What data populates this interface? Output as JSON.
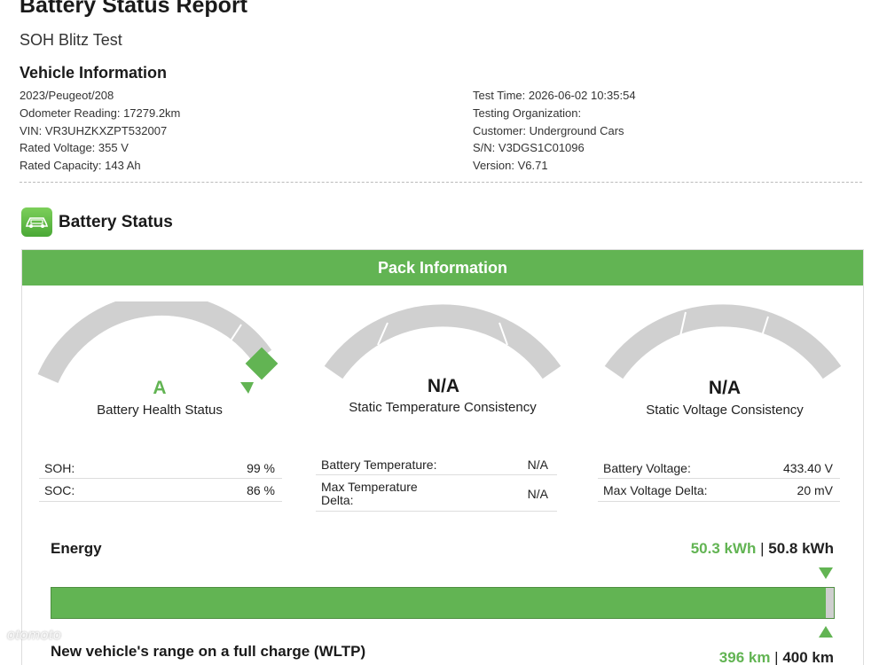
{
  "report": {
    "title": "Battery Status Report",
    "subtitle": "SOH Blitz Test"
  },
  "vehicle_info": {
    "heading": "Vehicle Information",
    "left": [
      "2023/Peugeot/208",
      "Odometer Reading: 17279.2km",
      "VIN: VR3UHZKXZPT532007",
      "Rated Voltage: 355 V",
      "Rated Capacity: 143 Ah"
    ],
    "right": [
      "Test Time: 2026-06-02 10:35:54",
      "Testing Organization:",
      "Customer: Underground Cars",
      "S/N: V3DGS1C01096",
      "Version: V6.71"
    ]
  },
  "battery_status": {
    "heading": "Battery Status",
    "icon": "battery-car-icon",
    "pack_header": "Pack Information",
    "gauges": [
      {
        "value": "A",
        "label": "Battery Health Status",
        "value_color": "#62b453"
      },
      {
        "value": "N/A",
        "label": "Static Temperature Consistency",
        "value_color": "#1a1a1a"
      },
      {
        "value": "N/A",
        "label": "Static Voltage Consistency",
        "value_color": "#1a1a1a"
      }
    ],
    "health_table": [
      {
        "key": "SOH:",
        "value": "99 %"
      },
      {
        "key": "SOC:",
        "value": "86 %"
      }
    ],
    "temperature_table": [
      {
        "key": "Battery Temperature:",
        "value": "N/A"
      },
      {
        "key": "Max Temperature Delta:",
        "value": "N/A"
      }
    ],
    "voltage_table": [
      {
        "key": "Battery Voltage:",
        "value": "433.40 V"
      },
      {
        "key": "Max Voltage Delta:",
        "value": "20 mV"
      }
    ]
  },
  "energy": {
    "label": "Energy",
    "current": "50.3 kWh",
    "separator": " | ",
    "total": "50.8 kWh",
    "fill_fraction": 0.99
  },
  "range": {
    "label": "New vehicle's range on a full charge (WLTP)",
    "current": "396 km",
    "separator": " | ",
    "total": "400 km"
  },
  "colors": {
    "accent_green": "#62b453",
    "gauge_gray": "#d0d0d0"
  },
  "watermark": "otomoto"
}
